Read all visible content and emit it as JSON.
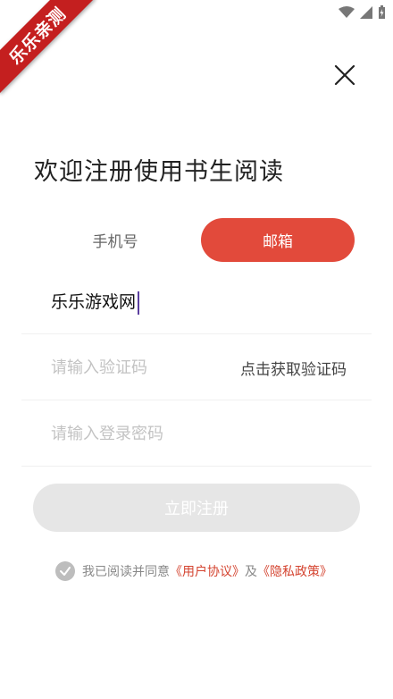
{
  "banner": {
    "text": "乐乐亲测"
  },
  "title": "欢迎注册使用书生阅读",
  "tabs": {
    "phone": "手机号",
    "email": "邮箱"
  },
  "email_field": {
    "value": "乐乐游戏网"
  },
  "code_field": {
    "placeholder": "请输入验证码",
    "get_code": "点击获取验证码"
  },
  "password_field": {
    "placeholder": "请输入登录密码"
  },
  "register_button": "立即注册",
  "agreement": {
    "prefix": "我已阅读并同意",
    "user_agreement": "《用户协议》",
    "and": "及",
    "privacy_policy": "《隐私政策》"
  },
  "colors": {
    "accent": "#e24a3b",
    "link": "#d4432f",
    "banner": "#c41f1f"
  },
  "icons": {
    "close": "close-icon",
    "check": "check-circle-icon",
    "wifi": "wifi-icon",
    "signal": "signal-icon",
    "battery": "battery-icon"
  }
}
